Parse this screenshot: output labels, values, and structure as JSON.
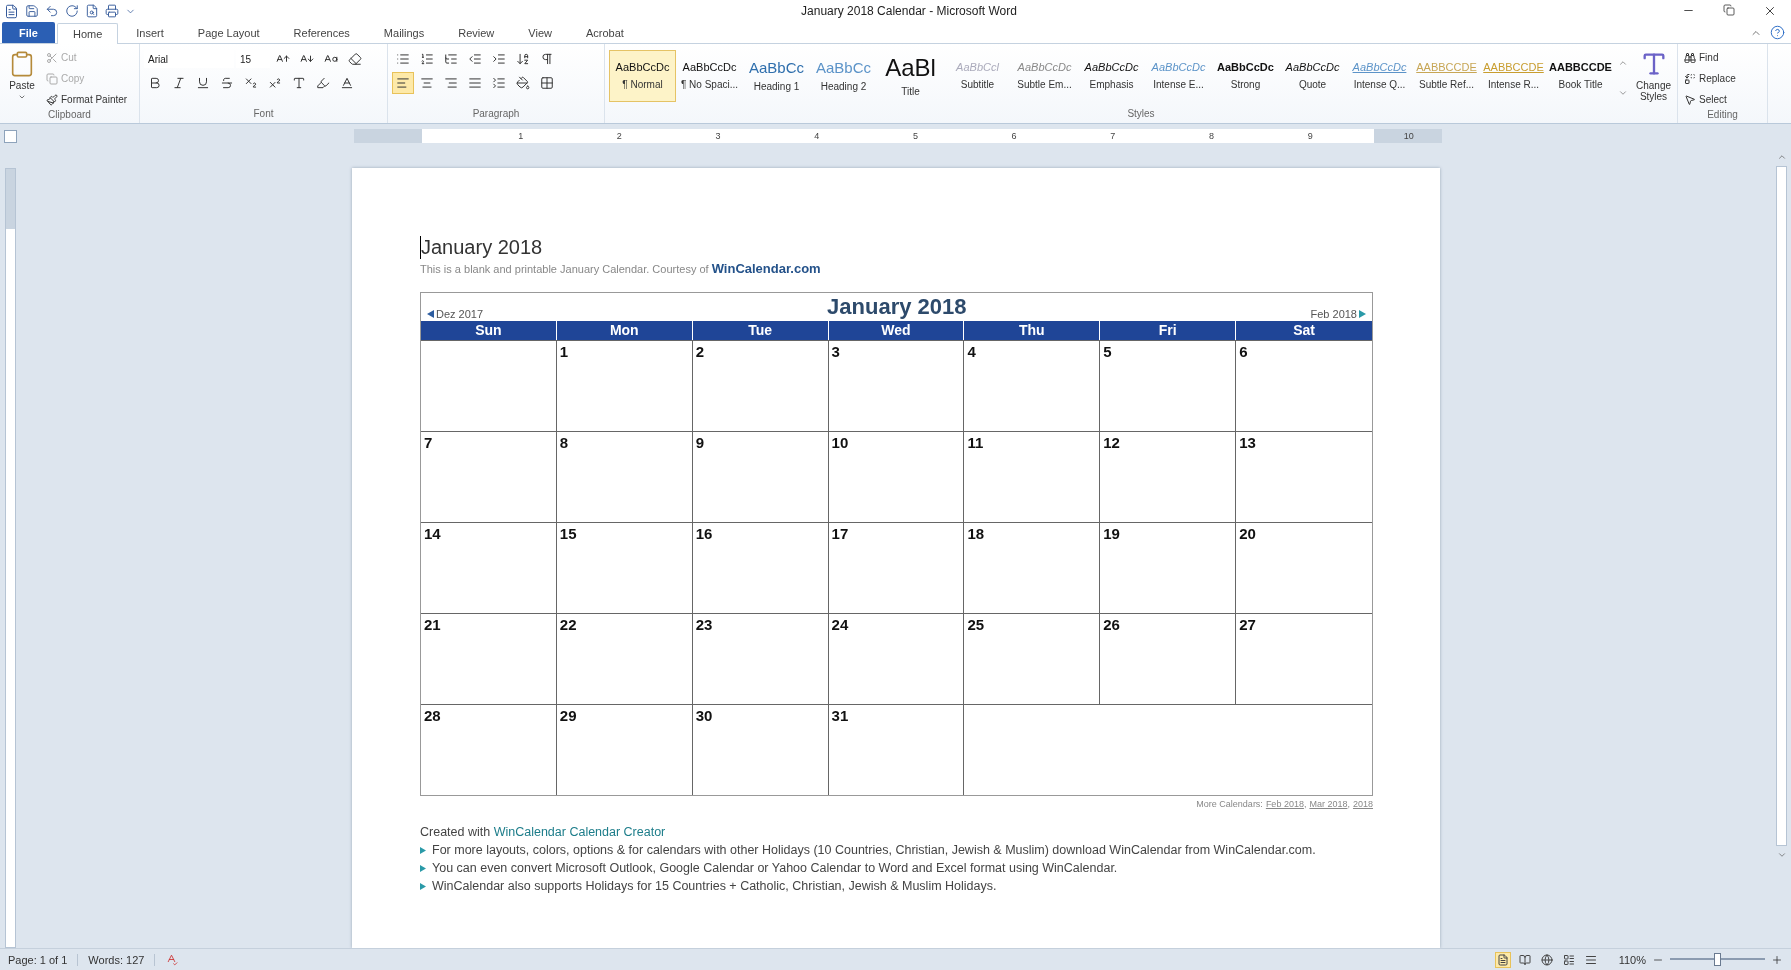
{
  "window": {
    "title": "January 2018 Calendar  -  Microsoft Word"
  },
  "tabs": [
    {
      "label": "File",
      "kind": "file",
      "selected": false
    },
    {
      "label": "Home",
      "kind": "tab",
      "selected": true
    },
    {
      "label": "Insert",
      "kind": "tab",
      "selected": false
    },
    {
      "label": "Page Layout",
      "kind": "tab",
      "selected": false
    },
    {
      "label": "References",
      "kind": "tab",
      "selected": false
    },
    {
      "label": "Mailings",
      "kind": "tab",
      "selected": false
    },
    {
      "label": "Review",
      "kind": "tab",
      "selected": false
    },
    {
      "label": "View",
      "kind": "tab",
      "selected": false
    },
    {
      "label": "Acrobat",
      "kind": "tab",
      "selected": false
    }
  ],
  "clipboard": {
    "group": "Clipboard",
    "paste": "Paste",
    "items": [
      {
        "label": "Cut",
        "disabled": true
      },
      {
        "label": "Copy",
        "disabled": true
      },
      {
        "label": "Format Painter",
        "disabled": false
      }
    ]
  },
  "font": {
    "group": "Font",
    "name": "Arial",
    "size": "15"
  },
  "paragraph": {
    "group": "Paragraph"
  },
  "styles": {
    "group": "Styles",
    "items": [
      {
        "preview": "AaBbCcDc",
        "label": "¶ Normal",
        "kind": "normal",
        "selected": true
      },
      {
        "preview": "AaBbCcDc",
        "label": "¶ No Spaci...",
        "kind": "normal",
        "selected": false
      },
      {
        "preview": "AaBbCc",
        "label": "Heading 1",
        "kind": "heading1",
        "selected": false
      },
      {
        "preview": "AaBbCc",
        "label": "Heading 2",
        "kind": "heading2",
        "selected": false
      },
      {
        "preview": "AaBl",
        "label": "Title",
        "kind": "title",
        "selected": false
      },
      {
        "preview": "AaBbCcl",
        "label": "Subtitle",
        "kind": "subtitle",
        "selected": false
      },
      {
        "preview": "AaBbCcDc",
        "label": "Subtle Em...",
        "kind": "subtle",
        "selected": false
      },
      {
        "preview": "AaBbCcDc",
        "label": "Emphasis",
        "kind": "emphasis",
        "selected": false
      },
      {
        "preview": "AaBbCcDc",
        "label": "Intense E...",
        "kind": "intense",
        "selected": false
      },
      {
        "preview": "AaBbCcDc",
        "label": "Strong",
        "kind": "strong",
        "selected": false
      },
      {
        "preview": "AaBbCcDc",
        "label": "Quote",
        "kind": "emphasis",
        "selected": false
      },
      {
        "preview": "AaBbCcDc",
        "label": "Intense Q...",
        "kind": "intensequote",
        "selected": false
      },
      {
        "preview": "AABBCCDE",
        "label": "Subtle Ref...",
        "kind": "subtleref",
        "selected": false
      },
      {
        "preview": "AABBCCDE",
        "label": "Intense R...",
        "kind": "intenseref",
        "selected": false
      },
      {
        "preview": "AABBCCDE",
        "label": "Book Title",
        "kind": "book",
        "selected": false
      }
    ],
    "change": "Change Styles"
  },
  "editing": {
    "group": "Editing",
    "items": [
      {
        "label": "Find",
        "kind": "find"
      },
      {
        "label": "Replace",
        "kind": "replace"
      },
      {
        "label": "Select",
        "kind": "select"
      }
    ]
  },
  "ruler": [
    "1",
    "2",
    "3",
    "4",
    "5",
    "6",
    "7",
    "8",
    "9",
    "10"
  ],
  "document": {
    "heading": "January 2018",
    "intro": "This is a blank and printable January Calendar.  Courtesy of",
    "intro_link": "WinCalendar.com",
    "calendar": {
      "title": "January  2018",
      "prev": "Dez 2017",
      "next": "Feb 2018",
      "weekdays": [
        "Sun",
        "Mon",
        "Tue",
        "Wed",
        "Thu",
        "Fri",
        "Sat"
      ],
      "weeks": [
        {
          "leading_empty": true,
          "days": [
            "1",
            "2",
            "3",
            "4",
            "5",
            "6"
          ]
        },
        {
          "days": [
            "7",
            "8",
            "9",
            "10",
            "11",
            "12",
            "13"
          ]
        },
        {
          "days": [
            "14",
            "15",
            "16",
            "17",
            "18",
            "19",
            "20"
          ]
        },
        {
          "days": [
            "21",
            "22",
            "23",
            "24",
            "25",
            "26",
            "27"
          ]
        },
        {
          "leading_empty": false,
          "days": [
            "28",
            "29",
            "30",
            "31"
          ]
        }
      ]
    },
    "more_label": "More Calendars:",
    "more_links": [
      "Feb 2018",
      "Mar 2018",
      "2018"
    ],
    "more_separator": ",",
    "created": "Created with",
    "created_link": "WinCalendar Calendar Creator",
    "bullets": [
      "For more layouts, colors, options & for calendars with other Holidays (10 Countries, Christian, Jewish & Muslim)  download WinCalendar from WinCalendar.com.",
      "You can even convert Microsoft Outlook, Google Calendar or Yahoo Calendar to Word and Excel format using WinCalendar.",
      "WinCalendar also supports Holidays for 15 Countries + Catholic, Christian, Jewish & Muslim Holidays."
    ]
  },
  "status_bar": {
    "page": "Page: 1 of 1",
    "words": "Words: 127",
    "zoom": {
      "label": "110%",
      "level": 0.5
    }
  }
}
